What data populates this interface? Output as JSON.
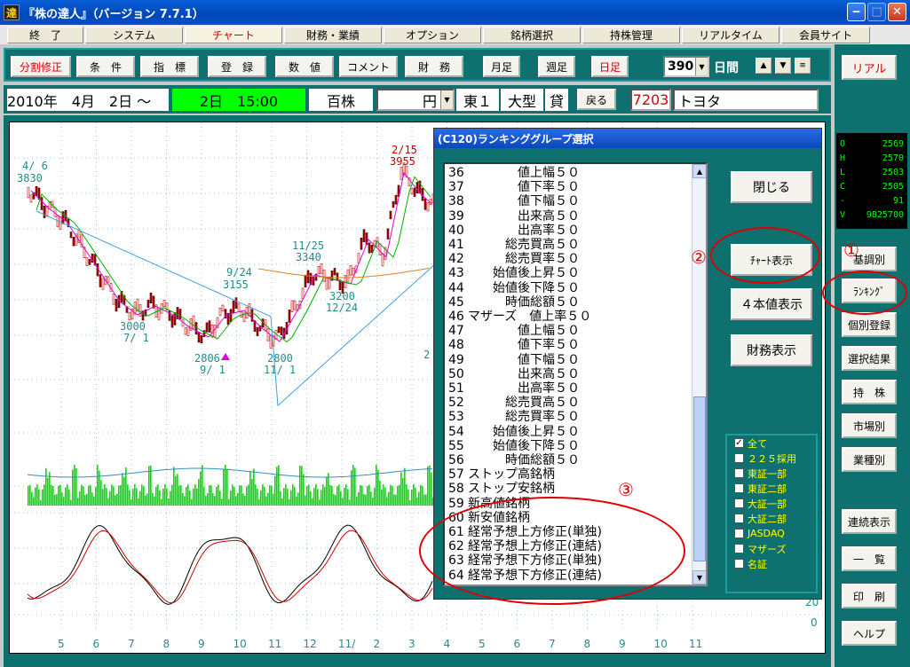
{
  "window": {
    "title": "『株の達人』（バージョン 7.7.1）",
    "icon": "達"
  },
  "menu": [
    "終　了",
    "システム",
    "チャート",
    "財務・業績",
    "オプション",
    "銘柄選択",
    "持株管理",
    "リアルタイム",
    "会員サイト"
  ],
  "toolbar": {
    "buttons": [
      "分割修正",
      "条　件",
      "指　標",
      "登　録",
      "数　値",
      "コメント",
      "財　務",
      "月足",
      "週足",
      "日足"
    ],
    "days_value": "390",
    "days_unit": "日間",
    "realtime_button": "リアル"
  },
  "info": {
    "date_from": "2010年　4月　2日 ～",
    "date_to": "2日　15:00",
    "lot": "百株",
    "currency": "円",
    "market": "東１",
    "size": "大型",
    "credit": "貸",
    "back_button": "戻る",
    "code": "7203",
    "name": "トヨタ"
  },
  "ohlc": [
    {
      "k": "O",
      "v": "2569"
    },
    {
      "k": "H",
      "v": "2570"
    },
    {
      "k": "L",
      "v": "2503"
    },
    {
      "k": "C",
      "v": "2505"
    },
    {
      "k": "-",
      "v": "91"
    },
    {
      "k": "V",
      "v": "9825700"
    }
  ],
  "side_buttons": [
    "基調別",
    "ﾗﾝｷﾝｸﾞ",
    "個別登録",
    "選択結果",
    "持　株",
    "市場別",
    "業種別",
    "連続表示",
    "一　覧",
    "印　刷",
    "ヘルプ"
  ],
  "dialog": {
    "title": "(C120)ランキンググループ選択",
    "buttons": [
      "閉じる",
      "ﾁｬｰﾄ表示",
      "４本値表示",
      "財務表示"
    ],
    "items": [
      {
        "n": "36",
        "t": "　　　　値上幅５０"
      },
      {
        "n": "37",
        "t": "　　　　値下率５０"
      },
      {
        "n": "38",
        "t": "　　　　値下幅５０"
      },
      {
        "n": "39",
        "t": "　　　　出来高５０"
      },
      {
        "n": "40",
        "t": "　　　　出高率５０"
      },
      {
        "n": "41",
        "t": "　　　総売買高５０"
      },
      {
        "n": "42",
        "t": "　　　総売買率５０"
      },
      {
        "n": "43",
        "t": "　　始値後上昇５０"
      },
      {
        "n": "44",
        "t": "　　始値後下降５０"
      },
      {
        "n": "45",
        "t": "　　　時価総額５０"
      },
      {
        "n": "46",
        "t": "マザーズ　値上率５０"
      },
      {
        "n": "47",
        "t": "　　　　値上幅５０"
      },
      {
        "n": "48",
        "t": "　　　　値下率５０"
      },
      {
        "n": "49",
        "t": "　　　　値下幅５０"
      },
      {
        "n": "50",
        "t": "　　　　出来高５０"
      },
      {
        "n": "51",
        "t": "　　　　出高率５０"
      },
      {
        "n": "52",
        "t": "　　　総売買高５０"
      },
      {
        "n": "53",
        "t": "　　　総売買率５０"
      },
      {
        "n": "54",
        "t": "　　始値後上昇５０"
      },
      {
        "n": "55",
        "t": "　　始値後下降５０"
      },
      {
        "n": "56",
        "t": "　　　時価総額５０"
      },
      {
        "n": "57",
        "t": "ストップ高銘柄"
      },
      {
        "n": "58",
        "t": "ストップ安銘柄"
      },
      {
        "n": "59",
        "t": "新高値銘柄"
      },
      {
        "n": "60",
        "t": "新安値銘柄"
      },
      {
        "n": "61",
        "t": "経常予想上方修正(単独)"
      },
      {
        "n": "62",
        "t": "経常予想上方修正(連結)"
      },
      {
        "n": "63",
        "t": "経常予想下方修正(単独)"
      },
      {
        "n": "64",
        "t": "経常予想下方修正(連結)"
      }
    ],
    "markets": [
      {
        "label": "全て",
        "checked": "✓"
      },
      {
        "label": "２２５採用",
        "checked": ""
      },
      {
        "label": "東証一部",
        "checked": ""
      },
      {
        "label": "東証二部",
        "checked": ""
      },
      {
        "label": "大証一部",
        "checked": ""
      },
      {
        "label": "大証二部",
        "checked": ""
      },
      {
        "label": "JASDAQ",
        "checked": ""
      },
      {
        "label": "マザーズ",
        "checked": ""
      },
      {
        "label": "名証",
        "checked": ""
      }
    ]
  },
  "chart_labels": {
    "p1": "4/ 6",
    "p1v": "3830",
    "p2": "9/24",
    "p2v": "3155",
    "p3": "3000",
    "p3v": "7/ 1",
    "p4": "2806",
    "p4v": "9/ 1",
    "p5": "2800",
    "p5v": "11/ 1",
    "p6": "11/25",
    "p6v": "3340",
    "p7": "3200",
    "p7v": "12/24",
    "p8": "2/15",
    "p8v": "3955",
    "p9": "2"
  },
  "x_ticks": [
    "5",
    "6",
    "7",
    "8",
    "9",
    "10",
    "11",
    "12",
    "11/",
    "2",
    "3",
    "4",
    "5",
    "6",
    "7",
    "8",
    "9",
    "10",
    "11"
  ],
  "osc_labels": [
    "20",
    "0"
  ],
  "annotations": [
    "①",
    "②",
    "③"
  ]
}
